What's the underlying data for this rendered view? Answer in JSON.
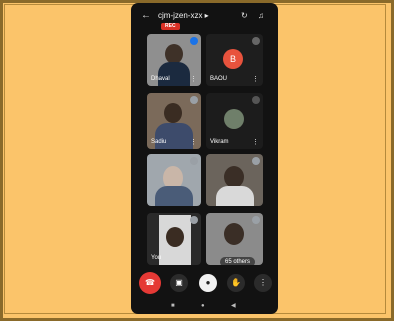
{
  "colors": {
    "background": "#fbc46a",
    "phone": "#121212",
    "accent_red": "#d93025"
  },
  "header": {
    "back_icon": "arrow-left-icon",
    "meeting_code": "cjm-jzen-xzx ▸",
    "rec_label": "REC",
    "camera_switch_icon": "camera-switch-icon",
    "speaker_icon": "speaker-icon"
  },
  "participants": [
    {
      "name": "Dhaval",
      "has_video": true
    },
    {
      "name": "BAOU",
      "initial": "B",
      "has_video": false
    },
    {
      "name": "Sadiu",
      "has_video": true
    },
    {
      "name": "Vikram",
      "has_video": true
    },
    {
      "name": "",
      "has_video": true
    },
    {
      "name": "",
      "has_video": true
    },
    {
      "name": "You",
      "has_video": true
    },
    {
      "name": "",
      "has_video": true
    }
  ],
  "others_label": "65 others",
  "controls": {
    "end_call_icon": "phone-hangup-icon",
    "camera_icon": "camera-icon",
    "mic_icon": "mic-icon",
    "hand_icon": "raise-hand-icon",
    "more_icon": "more-vert-icon"
  },
  "navbar": {
    "recent": "■",
    "home": "●",
    "back": "◀"
  }
}
